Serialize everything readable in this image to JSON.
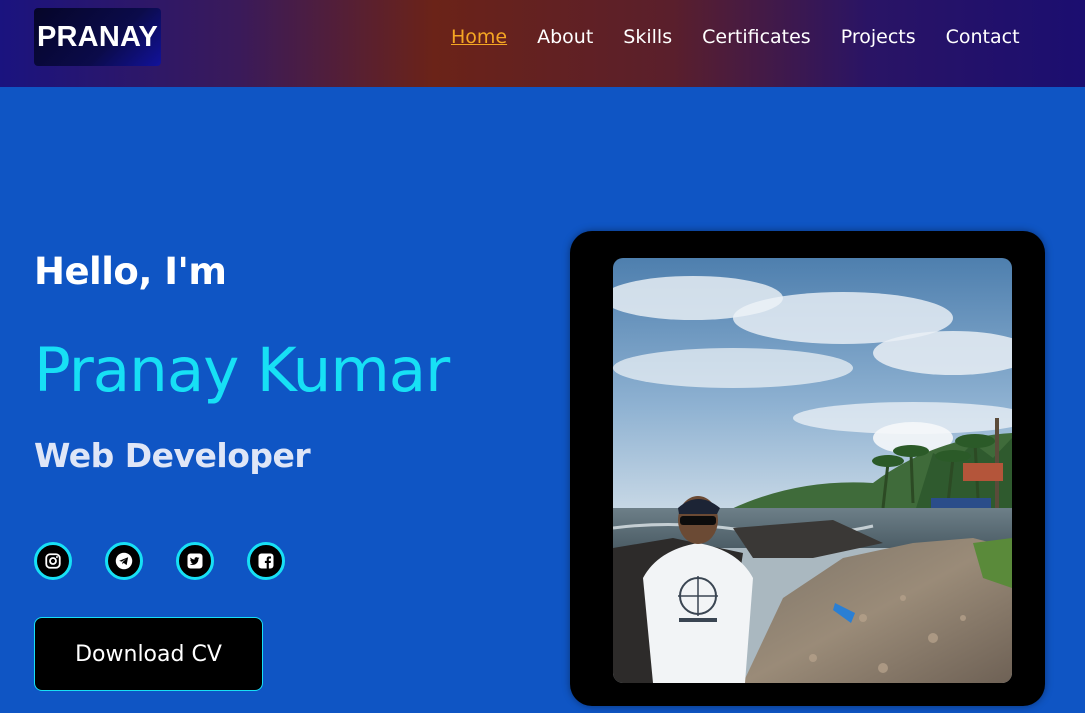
{
  "header": {
    "logo_text": "PRANAY",
    "nav": [
      {
        "label": "Home",
        "active": true
      },
      {
        "label": "About"
      },
      {
        "label": "Skills"
      },
      {
        "label": "Certificates"
      },
      {
        "label": "Projects"
      },
      {
        "label": "Contact"
      }
    ]
  },
  "hero": {
    "greeting": "Hello, I'm",
    "name": "Pranay Kumar",
    "role": "Web Developer",
    "socials": [
      {
        "icon": "instagram-icon"
      },
      {
        "icon": "telegram-icon"
      },
      {
        "icon": "twitter-icon"
      },
      {
        "icon": "facebook-icon"
      }
    ],
    "cta_label": "Download CV"
  },
  "colors": {
    "page_bg": "#0f55c4",
    "accent_cyan": "#17e0f5",
    "active_nav": "#f5a623",
    "button_bg": "#000000"
  }
}
